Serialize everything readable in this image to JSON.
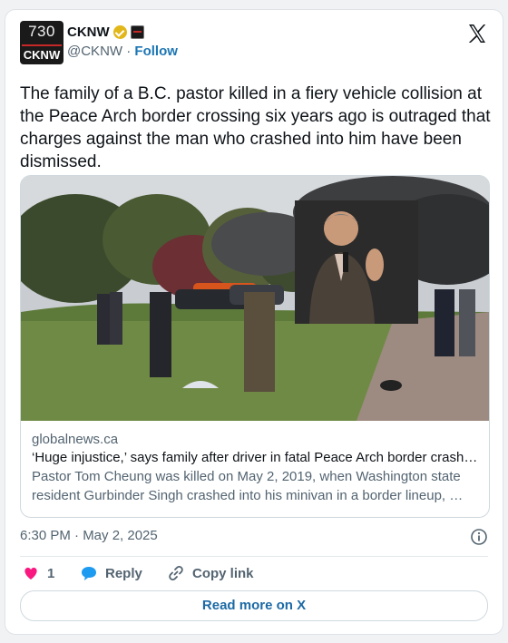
{
  "author": {
    "avatar_number": "730",
    "avatar_name": "CKNW",
    "display_name": "CKNW",
    "handle": "@CKNW",
    "separator": "·",
    "follow_label": "Follow"
  },
  "tweet": {
    "text": "The family of a B.C. pastor killed in a fiery vehicle collision at the Peace Arch border crossing six years ago is outraged that charges against the man who crashed into him have been dismissed."
  },
  "link_card": {
    "domain": "globalnews.ca",
    "title": "‘Huge injustice,’ says family after driver in fatal Peace Arch border crash…",
    "description": "Pastor Tom Cheung was killed on May 2, 2019, when Washington state resident Gurbinder Singh crashed into his minivan in a border lineup, …"
  },
  "timestamp": "6:30 PM · May 2, 2025",
  "actions": {
    "like_count": "1",
    "reply_label": "Reply",
    "copy_label": "Copy link"
  },
  "read_more_label": "Read more on X",
  "icons": {
    "verified": "verified-badge-icon",
    "affiliate": "affiliate-badge-icon",
    "logo": "x-logo-icon",
    "info": "info-icon",
    "like": "heart-icon",
    "reply": "speech-bubble-icon",
    "copy": "link-icon"
  },
  "colors": {
    "link_blue": "#1d6aa5",
    "heart_pink": "#f91880",
    "reply_blue": "#1d9bf0",
    "verified_gold": "#e2b719",
    "text": "#0f1419",
    "muted": "#536471"
  }
}
